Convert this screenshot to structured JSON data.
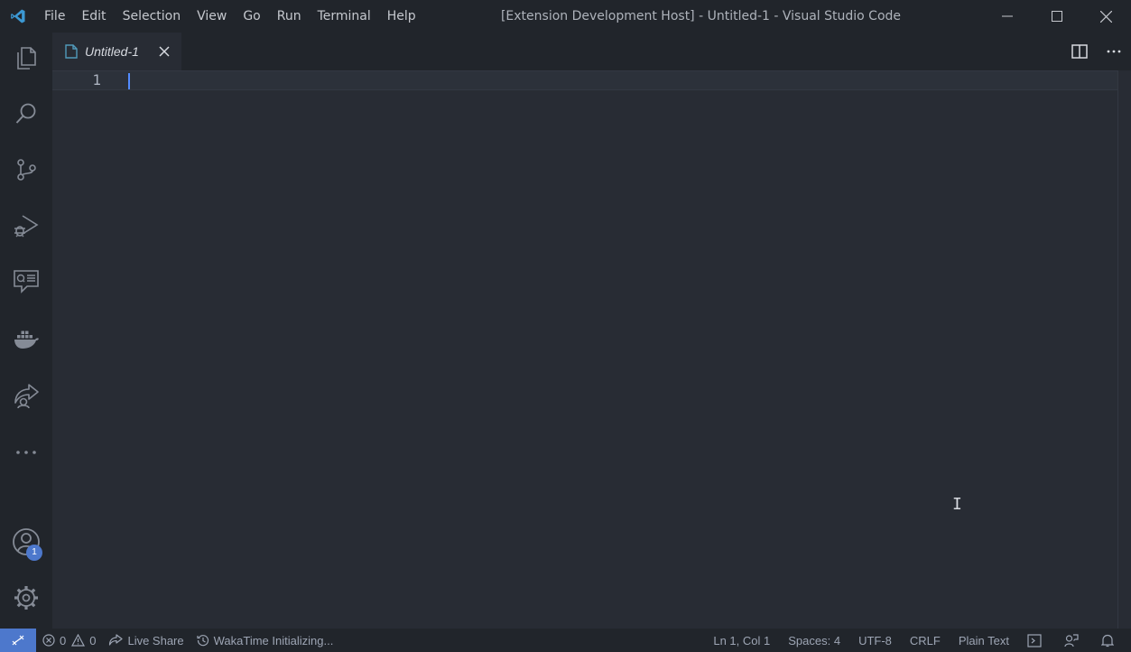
{
  "menu": [
    "File",
    "Edit",
    "Selection",
    "View",
    "Go",
    "Run",
    "Terminal",
    "Help"
  ],
  "window_title": "[Extension Development Host] - Untitled-1 - Visual Studio Code",
  "activity_badge": "1",
  "tab": {
    "label": "Untitled-1"
  },
  "editor": {
    "line_number": "1",
    "mouse_cursor_glyph": "I"
  },
  "status": {
    "errors": "0",
    "warnings": "0",
    "live_share": "Live Share",
    "wakatime": "WakaTime Initializing...",
    "position": "Ln 1, Col 1",
    "spaces": "Spaces: 4",
    "encoding": "UTF-8",
    "eol": "CRLF",
    "language": "Plain Text"
  },
  "icons": {
    "activity": [
      "explorer-icon",
      "search-icon",
      "source-control-icon",
      "run-debug-icon",
      "comments-icon",
      "docker-icon",
      "live-share-icon",
      "more-icon",
      "accounts-icon",
      "settings-gear-icon"
    ]
  },
  "colors": {
    "accent": "#4d78cc",
    "cursor": "#528bff",
    "editor_bg": "#282c34",
    "chrome_bg": "#21252b"
  }
}
